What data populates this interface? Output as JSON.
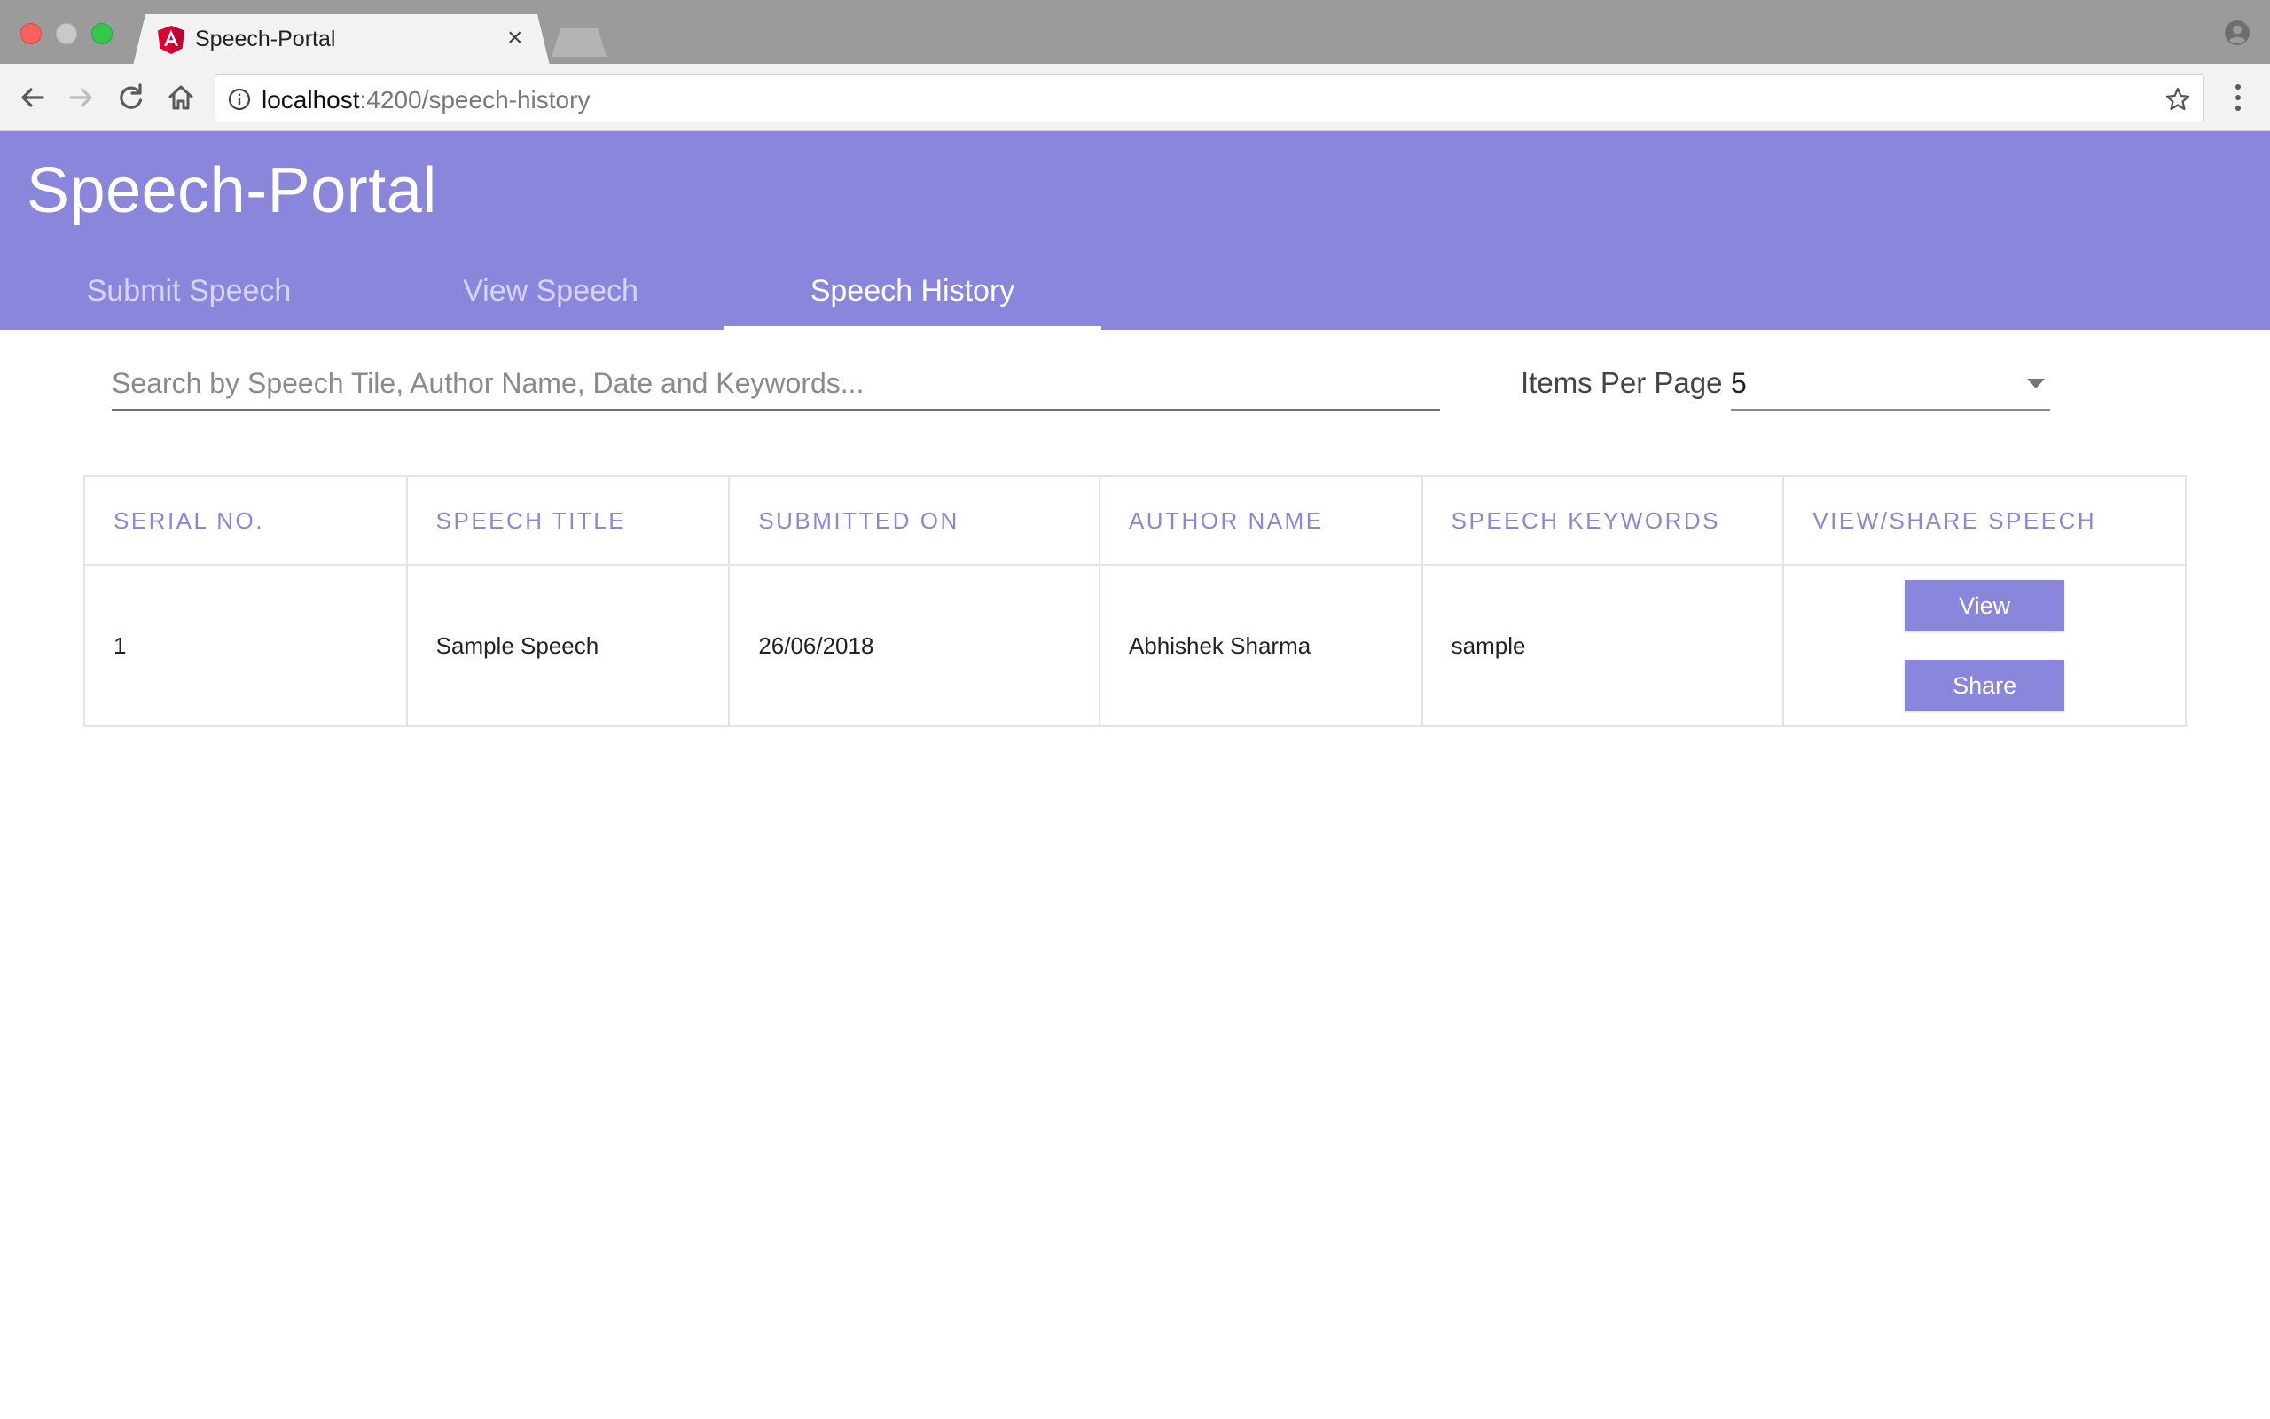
{
  "browser": {
    "tab_title": "Speech-Portal",
    "url_host": "localhost",
    "url_rest": ":4200/speech-history"
  },
  "app": {
    "title": "Speech-Portal",
    "nav_tabs": [
      {
        "label": "Submit Speech",
        "active": false
      },
      {
        "label": "View Speech",
        "active": false
      },
      {
        "label": "Speech History",
        "active": true
      }
    ]
  },
  "filters": {
    "search_placeholder": "Search by Speech Tile, Author Name, Date and Keywords...",
    "search_value": "",
    "items_per_page_label": "Items Per Page",
    "items_per_page_value": "5"
  },
  "table": {
    "columns": [
      "SERIAL NO.",
      "SPEECH TITLE",
      "SUBMITTED ON",
      "AUTHOR NAME",
      "SPEECH KEYWORDS",
      "VIEW/SHARE SPEECH"
    ],
    "rows": [
      {
        "serial": "1",
        "title": "Sample Speech",
        "submitted_on": "26/06/2018",
        "author": "Abhishek Sharma",
        "keywords": "sample",
        "view_label": "View",
        "share_label": "Share"
      }
    ]
  },
  "colors": {
    "accent": "#8a86dc",
    "chrome": "#9b9b9b",
    "toolbar": "#f2f2f2"
  },
  "icons": [
    "angular-logo-icon",
    "close-icon",
    "profile-icon",
    "back-arrow-icon",
    "forward-arrow-icon",
    "reload-icon",
    "home-icon",
    "info-icon",
    "star-icon",
    "more-vert-icon",
    "dropdown-arrow-icon"
  ]
}
